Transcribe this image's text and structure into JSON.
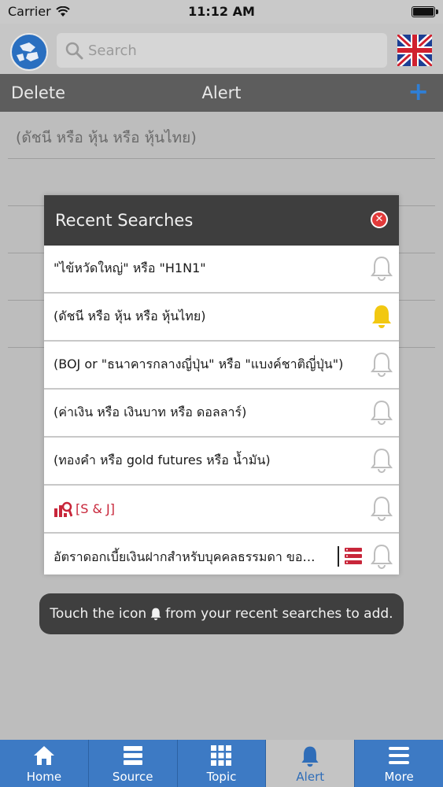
{
  "status_bar": {
    "carrier": "Carrier",
    "time": "11:12 AM"
  },
  "header": {
    "search_placeholder": "Search"
  },
  "toolbar": {
    "delete_label": "Delete",
    "title": "Alert",
    "add_label": "+"
  },
  "alert_list": [
    {
      "text": "(ดัชนี หรือ หุ้น หรือ หุ้นไทย)"
    }
  ],
  "modal": {
    "title": "Recent Searches",
    "items": [
      {
        "text": "\"ไข้หวัดใหญ่\" หรือ \"H1N1\"",
        "bell": "bell-outline-icon",
        "active": false
      },
      {
        "text": "(ดัชนี หรือ หุ้น หรือ หุ้นไทย)",
        "bell": "bell-filled-icon",
        "active": true
      },
      {
        "text": "(BOJ or \"ธนาคารกลางญี่ปุ่น\" หรือ \"แบงค์ชาติญี่ปุ่น\")",
        "bell": "bell-outline-icon",
        "active": false
      },
      {
        "text": "(ค่าเงิน หรือ เงินบาท หรือ ดอลลาร์)",
        "bell": "bell-outline-icon",
        "active": false
      },
      {
        "text": "(ทองคำ หรือ gold futures หรือ น้ำมัน)",
        "bell": "bell-outline-icon",
        "active": false
      },
      {
        "text": "[S & J]",
        "bell": "bell-outline-icon",
        "active": false,
        "leading_icon": "chart-search-icon"
      },
      {
        "text": "อัตราดอกเบี้ยเงินฝากสำหรับบุคคลธรรมดา ของธ...",
        "bell": "bell-outline-icon",
        "active": false,
        "trailing_icon": "stack-icon"
      }
    ]
  },
  "toast": {
    "prefix": "Touch the icon",
    "suffix": "from your recent searches to add."
  },
  "tabs": [
    {
      "label": "Home",
      "icon": "home-icon",
      "active": false
    },
    {
      "label": "Source",
      "icon": "source-icon",
      "active": false
    },
    {
      "label": "Topic",
      "icon": "grid-icon",
      "active": false
    },
    {
      "label": "Alert",
      "icon": "bell-icon",
      "active": true
    },
    {
      "label": "More",
      "icon": "menu-icon",
      "active": false
    }
  ],
  "colors": {
    "accent": "#3d7ac4",
    "bell_active": "#f2c811",
    "danger": "#e23a3a"
  }
}
